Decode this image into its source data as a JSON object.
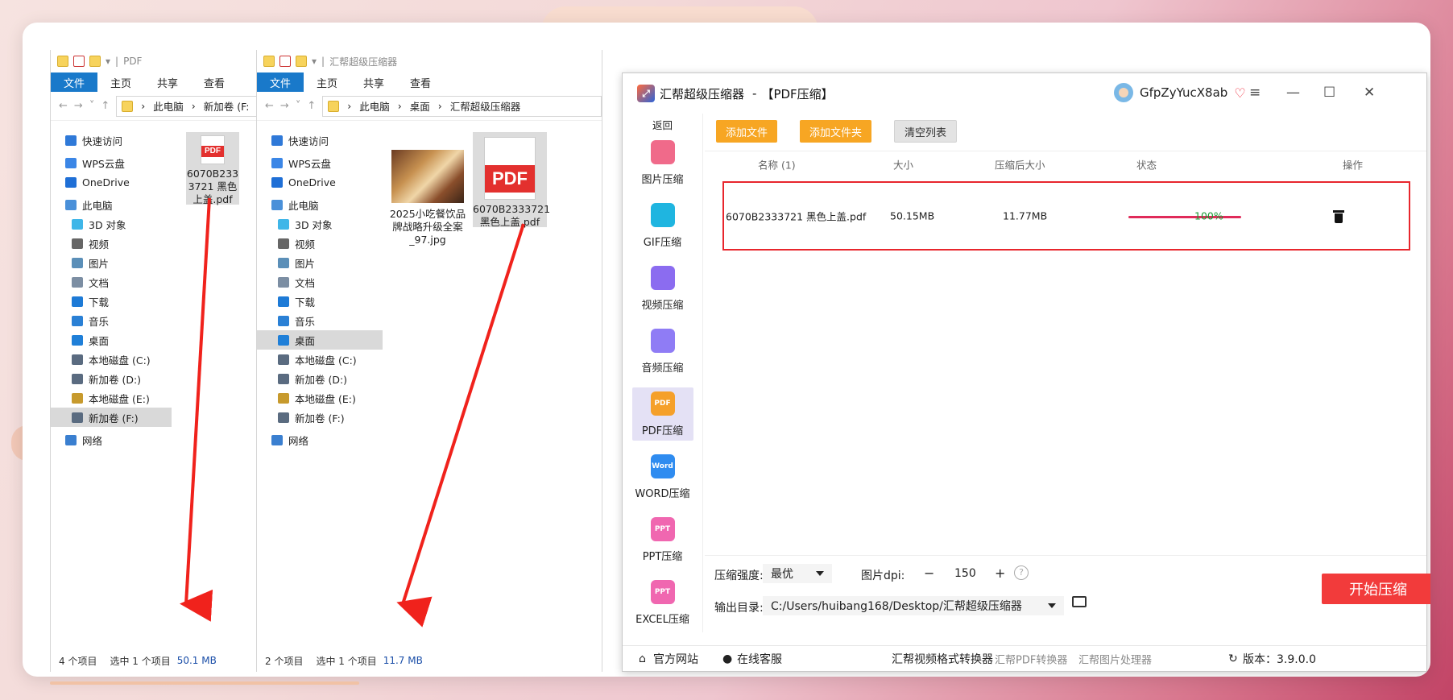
{
  "explorer1": {
    "title": "PDF",
    "ribbon": [
      "文件",
      "主页",
      "共享",
      "查看"
    ],
    "address": [
      "此电脑",
      "新加卷 (F:"
    ],
    "nav": [
      {
        "label": "快速访问",
        "icon": "star-icon",
        "color": "#2f79d8"
      },
      {
        "label": "WPS云盘",
        "icon": "cloud-icon",
        "color": "#3b86e6"
      },
      {
        "label": "OneDrive",
        "icon": "cloud-icon",
        "color": "#1f6fd6"
      },
      {
        "label": "此电脑",
        "icon": "computer-icon",
        "color": "#4a90d9"
      },
      {
        "label": "3D 对象",
        "icon": "cube-icon",
        "color": "#3fb6e8"
      },
      {
        "label": "视频",
        "icon": "video-icon",
        "color": "#666"
      },
      {
        "label": "图片",
        "icon": "image-icon",
        "color": "#5b8fb8"
      },
      {
        "label": "文档",
        "icon": "document-icon",
        "color": "#7c8ea3"
      },
      {
        "label": "下载",
        "icon": "download-icon",
        "color": "#1d7ad6"
      },
      {
        "label": "音乐",
        "icon": "music-icon",
        "color": "#2a80d5"
      },
      {
        "label": "桌面",
        "icon": "desktop-icon",
        "color": "#1f7fd8"
      },
      {
        "label": "本地磁盘 (C:)",
        "icon": "drive-icon",
        "color": "#5a6b80"
      },
      {
        "label": "新加卷 (D:)",
        "icon": "drive-icon",
        "color": "#5a6b80"
      },
      {
        "label": "本地磁盘 (E:)",
        "icon": "drive-icon",
        "color": "#c79a2d"
      },
      {
        "label": "新加卷 (F:)",
        "icon": "drive-icon",
        "color": "#5a6b80"
      },
      {
        "label": "网络",
        "icon": "network-icon",
        "color": "#3a7fd0"
      }
    ],
    "file": {
      "line1": "6070B233",
      "line2": "3721 黑色",
      "line3": "上盖.pdf"
    },
    "status": {
      "count": "4 个项目",
      "selected": "选中 1 个项目",
      "size": "50.1 MB"
    }
  },
  "explorer2": {
    "title": "汇帮超级压缩器",
    "ribbon": [
      "文件",
      "主页",
      "共享",
      "查看"
    ],
    "address": [
      "此电脑",
      "桌面",
      "汇帮超级压缩器"
    ],
    "nav": [
      {
        "label": "快速访问",
        "icon": "star-icon",
        "color": "#2f79d8"
      },
      {
        "label": "WPS云盘",
        "icon": "cloud-icon",
        "color": "#3b86e6"
      },
      {
        "label": "OneDrive",
        "icon": "cloud-icon",
        "color": "#1f6fd6"
      },
      {
        "label": "此电脑",
        "icon": "computer-icon",
        "color": "#4a90d9"
      },
      {
        "label": "3D 对象",
        "icon": "cube-icon",
        "color": "#3fb6e8"
      },
      {
        "label": "视频",
        "icon": "video-icon",
        "color": "#666"
      },
      {
        "label": "图片",
        "icon": "image-icon",
        "color": "#5b8fb8"
      },
      {
        "label": "文档",
        "icon": "document-icon",
        "color": "#7c8ea3"
      },
      {
        "label": "下载",
        "icon": "download-icon",
        "color": "#1d7ad6"
      },
      {
        "label": "音乐",
        "icon": "music-icon",
        "color": "#2a80d5"
      },
      {
        "label": "桌面",
        "icon": "desktop-icon",
        "color": "#1f7fd8"
      },
      {
        "label": "本地磁盘 (C:)",
        "icon": "drive-icon",
        "color": "#5a6b80"
      },
      {
        "label": "新加卷 (D:)",
        "icon": "drive-icon",
        "color": "#5a6b80"
      },
      {
        "label": "本地磁盘 (E:)",
        "icon": "drive-icon",
        "color": "#c79a2d"
      },
      {
        "label": "新加卷 (F:)",
        "icon": "drive-icon",
        "color": "#5a6b80"
      },
      {
        "label": "网络",
        "icon": "network-icon",
        "color": "#3a7fd0"
      }
    ],
    "files": [
      {
        "line1": "2025小吃餐饮品",
        "line2": "牌战略升级全案",
        "line3": "_97.jpg"
      },
      {
        "line1": "6070B2333721",
        "line2": "黑色上盖.pdf"
      }
    ],
    "status": {
      "count": "2 个项目",
      "selected": "选中 1 个项目",
      "size": "11.7 MB"
    }
  },
  "app": {
    "name": "汇帮超级压缩器",
    "mode": "【PDF压缩】",
    "user": "GfpZyYucX8ab",
    "back": "返回",
    "sidebar": [
      {
        "label": "图片压缩",
        "icon": "image-compress-icon",
        "color": "#f06a8a"
      },
      {
        "label": "GIF压缩",
        "icon": "gif-compress-icon",
        "color": "#1fb5e0"
      },
      {
        "label": "视频压缩",
        "icon": "video-compress-icon",
        "color": "#8b6cf0"
      },
      {
        "label": "音频压缩",
        "icon": "audio-compress-icon",
        "color": "#8f7cf5"
      },
      {
        "label": "PDF压缩",
        "icon": "pdf-compress-icon",
        "color": "#f5a02a",
        "tag": "PDF"
      },
      {
        "label": "WORD压缩",
        "icon": "word-compress-icon",
        "color": "#2f8cf0",
        "tag": "Word"
      },
      {
        "label": "PPT压缩",
        "icon": "ppt-compress-icon",
        "color": "#f067b0",
        "tag": "PPT"
      },
      {
        "label": "EXCEL压缩",
        "icon": "excel-compress-icon",
        "color": "#f067b0",
        "tag": "PPT"
      }
    ],
    "buttons": {
      "add_file": "添加文件",
      "add_folder": "添加文件夹",
      "clear": "清空列表"
    },
    "columns": {
      "name": "名称 (1)",
      "size": "大小",
      "compressed": "压缩后大小",
      "status": "状态",
      "action": "操作"
    },
    "row": {
      "name": "6070B2333721 黑色上盖.pdf",
      "size": "50.15MB",
      "compressed": "11.77MB",
      "progress": 100,
      "percent": "100%"
    },
    "settings": {
      "strength_label": "压缩强度:",
      "strength_value": "最优",
      "dpi_label": "图片dpi:",
      "dpi_minus": "−",
      "dpi_value": "150",
      "dpi_plus": "+",
      "help": "?",
      "output_label": "输出目录:",
      "output_path": "C:/Users/huibang168/Desktop/汇帮超级压缩器",
      "start": "开始压缩"
    },
    "footer": {
      "website": "官方网站",
      "service": "在线客服",
      "link1": "汇帮视频格式转换器",
      "link2": "汇帮PDF转换器",
      "link3": "汇帮图片处理器",
      "version": "版本：3.9.0.0"
    },
    "colors": {
      "accent": "#f7a623",
      "start": "#f23b3b",
      "progress": "#e02b5a",
      "highlight": "#e8262d"
    }
  }
}
